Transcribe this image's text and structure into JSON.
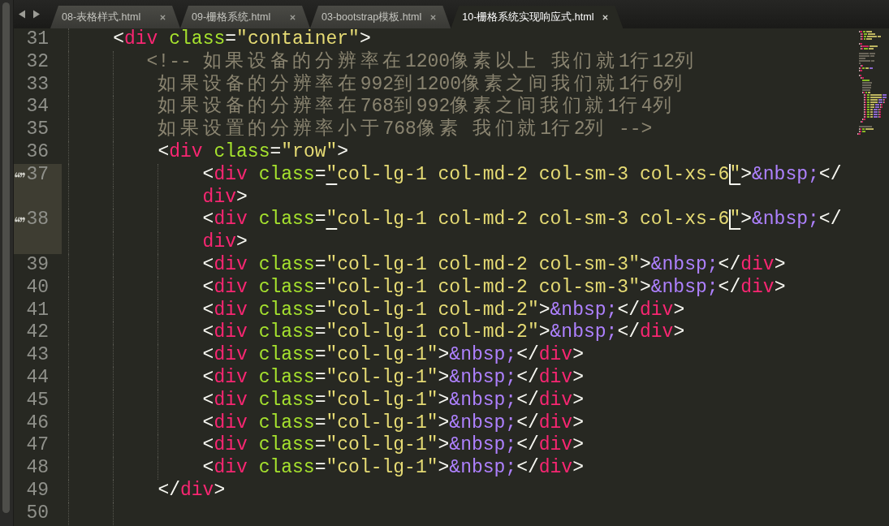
{
  "tab_bar": {
    "tabs": [
      {
        "label": "08-表格样式.html",
        "selected": false
      },
      {
        "label": "09-栅格系统.html",
        "selected": false
      },
      {
        "label": "03-bootstrap模板.html",
        "selected": false
      },
      {
        "label": "10-栅格系统实现响应式.html",
        "selected": true
      }
    ]
  },
  "editor": {
    "lines": [
      {
        "number": "31",
        "current": false,
        "gutter_mark": false,
        "rows": [
          {
            "indent": "    ",
            "tokens": [
              {
                "kind": "punct",
                "text": "<"
              },
              {
                "kind": "tag",
                "text": "div"
              },
              {
                "kind": "attr",
                "text": " class"
              },
              {
                "kind": "punct",
                "text": "="
              },
              {
                "kind": "string",
                "text": "\"container\""
              },
              {
                "kind": "punct",
                "text": ">"
              }
            ]
          }
        ]
      },
      {
        "number": "32",
        "current": false,
        "gutter_mark": false,
        "rows": [
          {
            "indent": "       ",
            "tokens": [
              {
                "kind": "comment",
                "text": "<!-- 如果设备的分辨率在1200像素以上 我们就1行12列"
              }
            ]
          }
        ]
      },
      {
        "number": "33",
        "current": false,
        "gutter_mark": false,
        "rows": [
          {
            "indent": "        ",
            "tokens": [
              {
                "kind": "comment",
                "text": "如果设备的分辨率在992到1200像素之间我们就1行6列"
              }
            ]
          }
        ]
      },
      {
        "number": "34",
        "current": false,
        "gutter_mark": false,
        "rows": [
          {
            "indent": "        ",
            "tokens": [
              {
                "kind": "comment",
                "text": "如果设备的分辨率在768到992像素之间我们就1行4列"
              }
            ]
          }
        ]
      },
      {
        "number": "35",
        "current": false,
        "gutter_mark": false,
        "rows": [
          {
            "indent": "        ",
            "tokens": [
              {
                "kind": "comment",
                "text": "如果设置的分辨率小于768像素 我们就1行2列 -->"
              }
            ]
          }
        ]
      },
      {
        "number": "36",
        "current": false,
        "gutter_mark": false,
        "rows": [
          {
            "indent": "        ",
            "tokens": [
              {
                "kind": "punct",
                "text": "<"
              },
              {
                "kind": "tag",
                "text": "div"
              },
              {
                "kind": "attr",
                "text": " class"
              },
              {
                "kind": "punct",
                "text": "="
              },
              {
                "kind": "string",
                "text": "\"row\""
              },
              {
                "kind": "punct",
                "text": ">"
              }
            ]
          }
        ]
      },
      {
        "number": "37",
        "current": true,
        "gutter_mark": true,
        "rows": [
          {
            "indent": "            ",
            "tokens": [
              {
                "kind": "punct",
                "text": "<"
              },
              {
                "kind": "tag",
                "text": "div"
              },
              {
                "kind": "attr",
                "text": " class"
              },
              {
                "kind": "punct",
                "text": "="
              },
              {
                "kind": "matched",
                "text": "\""
              },
              {
                "kind": "string",
                "text": "col-lg-1 col-md-2 col-sm-3 col-xs-6"
              },
              {
                "kind": "caret"
              },
              {
                "kind": "matched",
                "text": "\""
              },
              {
                "kind": "punct",
                "text": ">"
              },
              {
                "kind": "entity",
                "text": "&nbsp;"
              },
              {
                "kind": "punct",
                "text": "</"
              }
            ]
          },
          {
            "indent": "            ",
            "tokens": [
              {
                "kind": "tag",
                "text": "div"
              },
              {
                "kind": "punct",
                "text": ">"
              }
            ]
          }
        ]
      },
      {
        "number": "38",
        "current": true,
        "gutter_mark": true,
        "rows": [
          {
            "indent": "            ",
            "tokens": [
              {
                "kind": "punct",
                "text": "<"
              },
              {
                "kind": "tag",
                "text": "div"
              },
              {
                "kind": "attr",
                "text": " class"
              },
              {
                "kind": "punct",
                "text": "="
              },
              {
                "kind": "matched",
                "text": "\""
              },
              {
                "kind": "string",
                "text": "col-lg-1 col-md-2 col-sm-3 col-xs-6"
              },
              {
                "kind": "caret"
              },
              {
                "kind": "matched",
                "text": "\""
              },
              {
                "kind": "punct",
                "text": ">"
              },
              {
                "kind": "entity",
                "text": "&nbsp;"
              },
              {
                "kind": "punct",
                "text": "</"
              }
            ]
          },
          {
            "indent": "            ",
            "tokens": [
              {
                "kind": "tag",
                "text": "div"
              },
              {
                "kind": "punct",
                "text": ">"
              }
            ]
          }
        ]
      },
      {
        "number": "39",
        "current": false,
        "gutter_mark": false,
        "rows": [
          {
            "indent": "            ",
            "tokens": [
              {
                "kind": "punct",
                "text": "<"
              },
              {
                "kind": "tag",
                "text": "div"
              },
              {
                "kind": "attr",
                "text": " class"
              },
              {
                "kind": "punct",
                "text": "="
              },
              {
                "kind": "string",
                "text": "\"col-lg-1 col-md-2 col-sm-3\""
              },
              {
                "kind": "punct",
                "text": ">"
              },
              {
                "kind": "entity",
                "text": "&nbsp;"
              },
              {
                "kind": "punct",
                "text": "</"
              },
              {
                "kind": "tag",
                "text": "div"
              },
              {
                "kind": "punct",
                "text": ">"
              }
            ]
          }
        ]
      },
      {
        "number": "40",
        "current": false,
        "gutter_mark": false,
        "rows": [
          {
            "indent": "            ",
            "tokens": [
              {
                "kind": "punct",
                "text": "<"
              },
              {
                "kind": "tag",
                "text": "div"
              },
              {
                "kind": "attr",
                "text": " class"
              },
              {
                "kind": "punct",
                "text": "="
              },
              {
                "kind": "string",
                "text": "\"col-lg-1 col-md-2 col-sm-3\""
              },
              {
                "kind": "punct",
                "text": ">"
              },
              {
                "kind": "entity",
                "text": "&nbsp;"
              },
              {
                "kind": "punct",
                "text": "</"
              },
              {
                "kind": "tag",
                "text": "div"
              },
              {
                "kind": "punct",
                "text": ">"
              }
            ]
          }
        ]
      },
      {
        "number": "41",
        "current": false,
        "gutter_mark": false,
        "rows": [
          {
            "indent": "            ",
            "tokens": [
              {
                "kind": "punct",
                "text": "<"
              },
              {
                "kind": "tag",
                "text": "div"
              },
              {
                "kind": "attr",
                "text": " class"
              },
              {
                "kind": "punct",
                "text": "="
              },
              {
                "kind": "string",
                "text": "\"col-lg-1 col-md-2\""
              },
              {
                "kind": "punct",
                "text": ">"
              },
              {
                "kind": "entity",
                "text": "&nbsp;"
              },
              {
                "kind": "punct",
                "text": "</"
              },
              {
                "kind": "tag",
                "text": "div"
              },
              {
                "kind": "punct",
                "text": ">"
              }
            ]
          }
        ]
      },
      {
        "number": "42",
        "current": false,
        "gutter_mark": false,
        "rows": [
          {
            "indent": "            ",
            "tokens": [
              {
                "kind": "punct",
                "text": "<"
              },
              {
                "kind": "tag",
                "text": "div"
              },
              {
                "kind": "attr",
                "text": " class"
              },
              {
                "kind": "punct",
                "text": "="
              },
              {
                "kind": "string",
                "text": "\"col-lg-1 col-md-2\""
              },
              {
                "kind": "punct",
                "text": ">"
              },
              {
                "kind": "entity",
                "text": "&nbsp;"
              },
              {
                "kind": "punct",
                "text": "</"
              },
              {
                "kind": "tag",
                "text": "div"
              },
              {
                "kind": "punct",
                "text": ">"
              }
            ]
          }
        ]
      },
      {
        "number": "43",
        "current": false,
        "gutter_mark": false,
        "rows": [
          {
            "indent": "            ",
            "tokens": [
              {
                "kind": "punct",
                "text": "<"
              },
              {
                "kind": "tag",
                "text": "div"
              },
              {
                "kind": "attr",
                "text": " class"
              },
              {
                "kind": "punct",
                "text": "="
              },
              {
                "kind": "string",
                "text": "\"col-lg-1\""
              },
              {
                "kind": "punct",
                "text": ">"
              },
              {
                "kind": "entity",
                "text": "&nbsp;"
              },
              {
                "kind": "punct",
                "text": "</"
              },
              {
                "kind": "tag",
                "text": "div"
              },
              {
                "kind": "punct",
                "text": ">"
              }
            ]
          }
        ]
      },
      {
        "number": "44",
        "current": false,
        "gutter_mark": false,
        "rows": [
          {
            "indent": "            ",
            "tokens": [
              {
                "kind": "punct",
                "text": "<"
              },
              {
                "kind": "tag",
                "text": "div"
              },
              {
                "kind": "attr",
                "text": " class"
              },
              {
                "kind": "punct",
                "text": "="
              },
              {
                "kind": "string",
                "text": "\"col-lg-1\""
              },
              {
                "kind": "punct",
                "text": ">"
              },
              {
                "kind": "entity",
                "text": "&nbsp;"
              },
              {
                "kind": "punct",
                "text": "</"
              },
              {
                "kind": "tag",
                "text": "div"
              },
              {
                "kind": "punct",
                "text": ">"
              }
            ]
          }
        ]
      },
      {
        "number": "45",
        "current": false,
        "gutter_mark": false,
        "rows": [
          {
            "indent": "            ",
            "tokens": [
              {
                "kind": "punct",
                "text": "<"
              },
              {
                "kind": "tag",
                "text": "div"
              },
              {
                "kind": "attr",
                "text": " class"
              },
              {
                "kind": "punct",
                "text": "="
              },
              {
                "kind": "string",
                "text": "\"col-lg-1\""
              },
              {
                "kind": "punct",
                "text": ">"
              },
              {
                "kind": "entity",
                "text": "&nbsp;"
              },
              {
                "kind": "punct",
                "text": "</"
              },
              {
                "kind": "tag",
                "text": "div"
              },
              {
                "kind": "punct",
                "text": ">"
              }
            ]
          }
        ]
      },
      {
        "number": "46",
        "current": false,
        "gutter_mark": false,
        "rows": [
          {
            "indent": "            ",
            "tokens": [
              {
                "kind": "punct",
                "text": "<"
              },
              {
                "kind": "tag",
                "text": "div"
              },
              {
                "kind": "attr",
                "text": " class"
              },
              {
                "kind": "punct",
                "text": "="
              },
              {
                "kind": "string",
                "text": "\"col-lg-1\""
              },
              {
                "kind": "punct",
                "text": ">"
              },
              {
                "kind": "entity",
                "text": "&nbsp;"
              },
              {
                "kind": "punct",
                "text": "</"
              },
              {
                "kind": "tag",
                "text": "div"
              },
              {
                "kind": "punct",
                "text": ">"
              }
            ]
          }
        ]
      },
      {
        "number": "47",
        "current": false,
        "gutter_mark": false,
        "rows": [
          {
            "indent": "            ",
            "tokens": [
              {
                "kind": "punct",
                "text": "<"
              },
              {
                "kind": "tag",
                "text": "div"
              },
              {
                "kind": "attr",
                "text": " class"
              },
              {
                "kind": "punct",
                "text": "="
              },
              {
                "kind": "string",
                "text": "\"col-lg-1\""
              },
              {
                "kind": "punct",
                "text": ">"
              },
              {
                "kind": "entity",
                "text": "&nbsp;"
              },
              {
                "kind": "punct",
                "text": "</"
              },
              {
                "kind": "tag",
                "text": "div"
              },
              {
                "kind": "punct",
                "text": ">"
              }
            ]
          }
        ]
      },
      {
        "number": "48",
        "current": false,
        "gutter_mark": false,
        "rows": [
          {
            "indent": "            ",
            "tokens": [
              {
                "kind": "punct",
                "text": "<"
              },
              {
                "kind": "tag",
                "text": "div"
              },
              {
                "kind": "attr",
                "text": " class"
              },
              {
                "kind": "punct",
                "text": "="
              },
              {
                "kind": "string",
                "text": "\"col-lg-1\""
              },
              {
                "kind": "punct",
                "text": ">"
              },
              {
                "kind": "entity",
                "text": "&nbsp;"
              },
              {
                "kind": "punct",
                "text": "</"
              },
              {
                "kind": "tag",
                "text": "div"
              },
              {
                "kind": "punct",
                "text": ">"
              }
            ]
          }
        ]
      },
      {
        "number": "49",
        "current": false,
        "gutter_mark": false,
        "rows": [
          {
            "indent": "        ",
            "tokens": [
              {
                "kind": "punct",
                "text": "</"
              },
              {
                "kind": "tag",
                "text": "div"
              },
              {
                "kind": "punct",
                "text": ">"
              }
            ]
          }
        ]
      },
      {
        "number": "50",
        "current": false,
        "gutter_mark": false,
        "rows": [
          {
            "indent": "        "
          }
        ]
      }
    ]
  }
}
